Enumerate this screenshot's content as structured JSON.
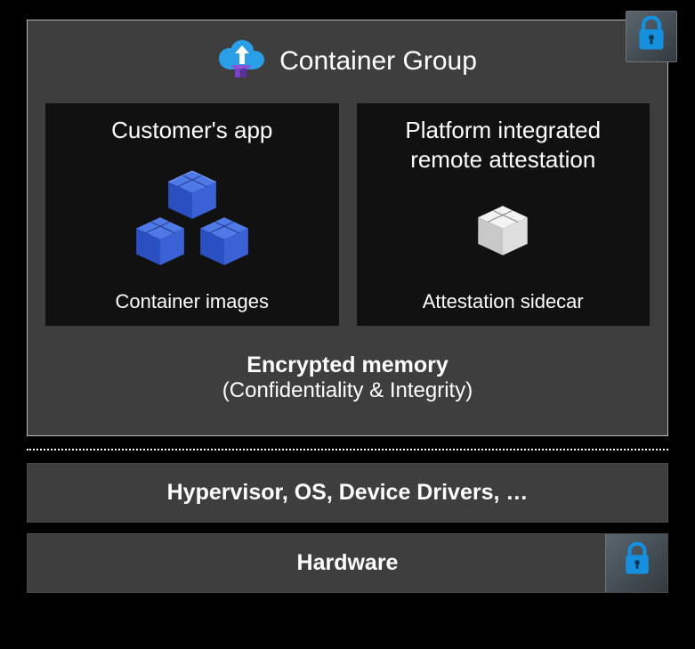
{
  "diagram": {
    "container_group_title": "Container Group",
    "cards": {
      "left": {
        "title": "Customer's app",
        "footer": "Container images"
      },
      "right": {
        "title": "Platform integrated remote attestation",
        "footer": "Attestation sidecar"
      }
    },
    "memory": {
      "title": "Encrypted memory",
      "subtitle": "(Confidentiality & Integrity)"
    },
    "stack": {
      "row1": "Hypervisor, OS, Device Drivers, …",
      "row2": "Hardware"
    }
  },
  "colors": {
    "lock": "#1490df",
    "box_blue_dark": "#2a4fc0",
    "box_blue_light": "#4f79e6",
    "box_white": "#e8e8e8",
    "cloud": "#2a9fe8"
  }
}
